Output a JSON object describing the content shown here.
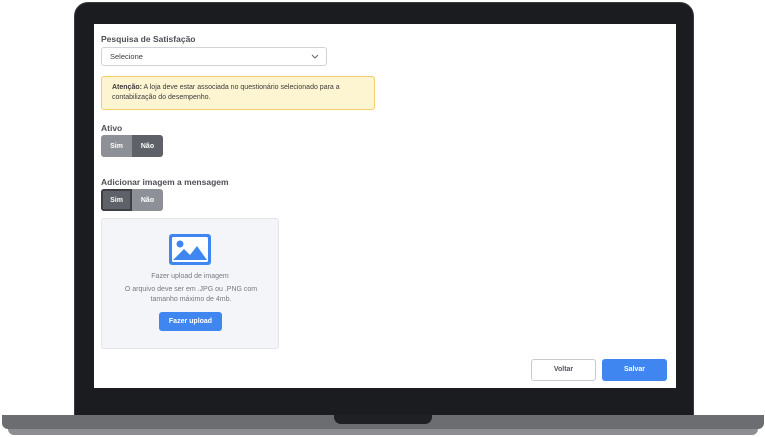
{
  "survey": {
    "label": "Pesquisa de Satisfação",
    "selected": "Selecione"
  },
  "alert": {
    "bold": "Atenção:",
    "text": " A loja deve estar associada no questionário selecionado para a contabilização do desempenho."
  },
  "active": {
    "label": "Ativo",
    "yes": "Sim",
    "no": "Não",
    "selected": "Não"
  },
  "image": {
    "label": "Adicionar imagem a mensagem",
    "yes": "Sim",
    "no": "Não",
    "selected": "Sim"
  },
  "upload": {
    "title": "Fazer upload de imagem",
    "description": "O arquivo deve ser em .JPG ou .PNG com tamanho máximo de 4mb.",
    "button": "Fazer upload"
  },
  "footer": {
    "back": "Voltar",
    "save": "Salvar"
  },
  "colors": {
    "primary": "#3f86f0",
    "alert_bg": "#fdf4d2",
    "toggle_active": "#5f6168"
  }
}
